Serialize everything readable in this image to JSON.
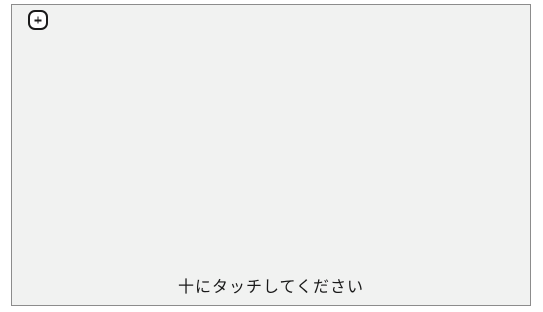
{
  "calibration": {
    "target_icon": "plus-icon",
    "instruction": "十にタッチしてください"
  }
}
